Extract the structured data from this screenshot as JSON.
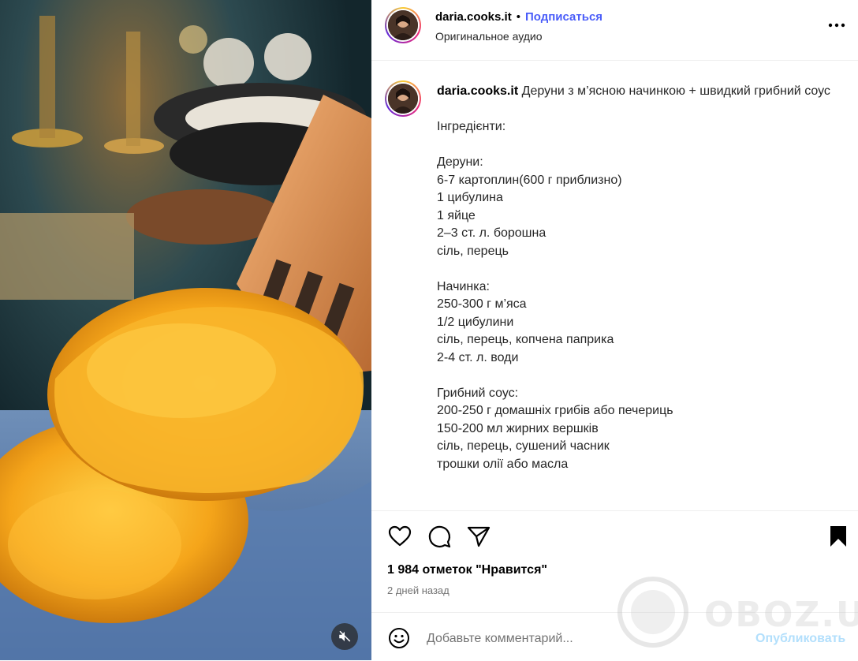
{
  "header": {
    "username": "daria.cooks.it",
    "separator": "•",
    "follow_label": "Подписаться",
    "audio_label": "Оригинальное аудио",
    "more_icon": "more-horizontal-icon"
  },
  "caption": {
    "username": "daria.cooks.it",
    "text": "Деруни з м’ясною начинкою + швидкий грибний соус\n\nІнгредієнти:\n\nДеруни:\n6-7 картоплин(600 г приблизно)\n1 цибулина\n1 яйце\n2–3 ст. л. борошна\nсіль, перець\n\nНачинка:\n250-300 г м’яса\n1/2 цибулини\nсіль, перець, копчена паприка\n2-4 ст. л. води\n\nГрибний соус:\n200-250 г домашніх грибів або печериць\n150-200 мл жирних вершків\nсіль, перець, сушений часник\nтрошки олії або масла"
  },
  "actions": {
    "icons": [
      "heart-icon",
      "comment-icon",
      "share-icon",
      "bookmark-icon"
    ],
    "likes_label": "1 984 отметок \"Нравится\"",
    "time_label": "2 дней назад"
  },
  "comment": {
    "placeholder": "Добавьте комментарий...",
    "post_label": "Опубликовать",
    "emoji_icon": "emoji-icon"
  },
  "media": {
    "mute_icon": "muted-speaker-icon"
  },
  "watermark": {
    "text": "OBOZ.UA"
  },
  "colors": {
    "accent": "#4a5df9",
    "post_disabled": "#b2dffc",
    "secondary_text": "#737373",
    "divider": "#efefef"
  }
}
